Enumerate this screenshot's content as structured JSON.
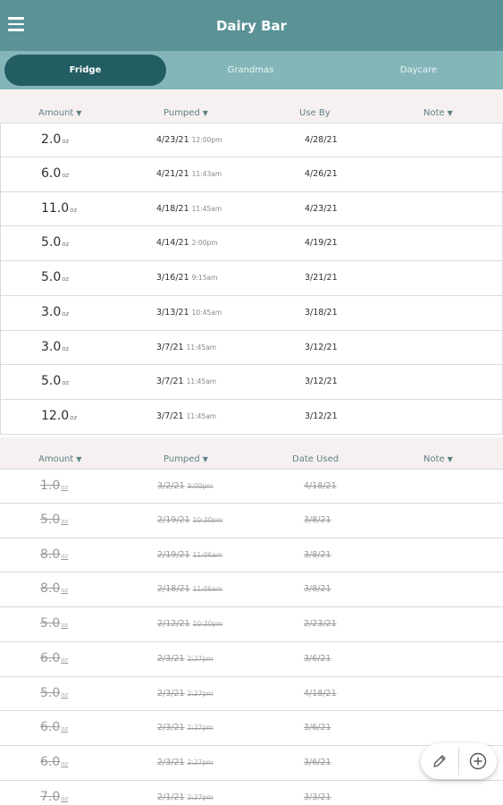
{
  "app": {
    "title": "Dairy Bar"
  },
  "tabs": [
    {
      "label": "Fridge",
      "active": true
    },
    {
      "label": "Grandmas",
      "active": false
    },
    {
      "label": "Daycare",
      "active": false
    }
  ],
  "fridge": {
    "headers": {
      "amount": "Amount",
      "pumped": "Pumped",
      "use_by": "Use By",
      "note": "Note"
    },
    "rows": [
      {
        "amount": "2.0",
        "unit": "oz",
        "pumped_date": "4/23/21",
        "pumped_time": "12:00pm",
        "use_by": "4/28/21"
      },
      {
        "amount": "6.0",
        "unit": "oz",
        "pumped_date": "4/21/21",
        "pumped_time": "11:43am",
        "use_by": "4/26/21"
      },
      {
        "amount": "11.0",
        "unit": "oz",
        "pumped_date": "4/18/21",
        "pumped_time": "11:45am",
        "use_by": "4/23/21"
      },
      {
        "amount": "5.0",
        "unit": "oz",
        "pumped_date": "4/14/21",
        "pumped_time": "2:00pm",
        "use_by": "4/19/21"
      },
      {
        "amount": "5.0",
        "unit": "oz",
        "pumped_date": "3/16/21",
        "pumped_time": "9:15am",
        "use_by": "3/21/21"
      },
      {
        "amount": "3.0",
        "unit": "oz",
        "pumped_date": "3/13/21",
        "pumped_time": "10:45am",
        "use_by": "3/18/21"
      },
      {
        "amount": "3.0",
        "unit": "oz",
        "pumped_date": "3/7/21",
        "pumped_time": "11:45am",
        "use_by": "3/12/21"
      },
      {
        "amount": "5.0",
        "unit": "oz",
        "pumped_date": "3/7/21",
        "pumped_time": "11:45am",
        "use_by": "3/12/21"
      },
      {
        "amount": "12.0",
        "unit": "oz",
        "pumped_date": "3/7/21",
        "pumped_time": "11:45am",
        "use_by": "3/12/21"
      }
    ]
  },
  "used": {
    "headers": {
      "amount": "Amount",
      "pumped": "Pumped",
      "date_used": "Date Used",
      "note": "Note"
    },
    "rows": [
      {
        "amount": "1.0",
        "unit": "oz",
        "pumped_date": "3/2/21",
        "pumped_time": "9:00pm",
        "date_used": "4/18/21"
      },
      {
        "amount": "5.0",
        "unit": "oz",
        "pumped_date": "2/19/21",
        "pumped_time": "10:30pm",
        "date_used": "3/8/21"
      },
      {
        "amount": "8.0",
        "unit": "oz",
        "pumped_date": "2/19/21",
        "pumped_time": "11:06am",
        "date_used": "3/8/21"
      },
      {
        "amount": "8.0",
        "unit": "oz",
        "pumped_date": "2/18/21",
        "pumped_time": "11:06am",
        "date_used": "3/8/21"
      },
      {
        "amount": "5.0",
        "unit": "oz",
        "pumped_date": "2/12/21",
        "pumped_time": "10:30pm",
        "date_used": "2/23/21"
      },
      {
        "amount": "6.0",
        "unit": "oz",
        "pumped_date": "2/3/21",
        "pumped_time": "2:27pm",
        "date_used": "3/6/21"
      },
      {
        "amount": "5.0",
        "unit": "oz",
        "pumped_date": "2/3/21",
        "pumped_time": "2:27pm",
        "date_used": "4/18/21"
      },
      {
        "amount": "6.0",
        "unit": "oz",
        "pumped_date": "2/3/21",
        "pumped_time": "2:27pm",
        "date_used": "3/6/21"
      },
      {
        "amount": "6.0",
        "unit": "oz",
        "pumped_date": "2/3/21",
        "pumped_time": "2:27pm",
        "date_used": "3/6/21"
      },
      {
        "amount": "7.0",
        "unit": "oz",
        "pumped_date": "2/1/21",
        "pumped_time": "2:27pm",
        "date_used": "3/3/21"
      }
    ]
  },
  "fab": {
    "edit_icon": "pencil-icon",
    "add_icon": "plus-circle-icon"
  },
  "colors": {
    "primary": "#5a9296",
    "tabbar": "#84b6b9",
    "active_tab": "#225d63",
    "header_bg": "#f6f0f0",
    "header_text": "#5d8286"
  }
}
